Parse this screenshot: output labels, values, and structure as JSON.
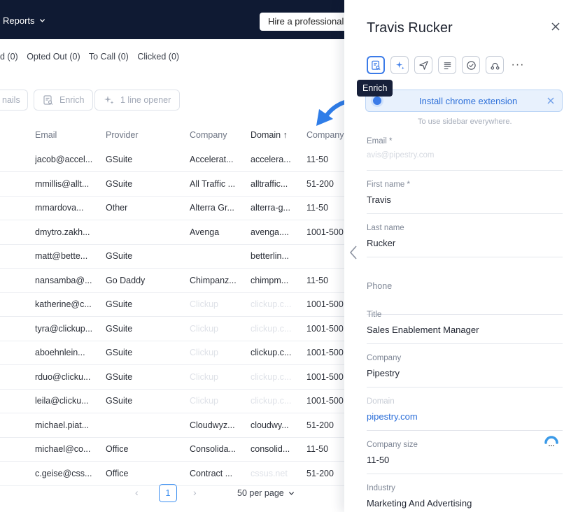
{
  "topbar": {
    "reports_label": "Reports",
    "hire_label": "Hire a professional"
  },
  "filters": [
    "d (0)",
    "Opted Out (0)",
    "To Call (0)",
    "Clicked (0)"
  ],
  "actions": {
    "emails_label": "nails",
    "enrich_label": "Enrich",
    "opener_label": "1 line opener"
  },
  "table": {
    "headers": {
      "email": "Email",
      "provider": "Provider",
      "company": "Company",
      "domain": "Domain ↑",
      "size": "Company"
    },
    "rows": [
      {
        "email": "jacob@accel...",
        "provider": "GSuite",
        "company": "Accelerat...",
        "domain": "accelera...",
        "size": "11-50"
      },
      {
        "email": "mmillis@allt...",
        "provider": "GSuite",
        "company": "All Traffic ...",
        "domain": "alltraffic...",
        "size": "51-200"
      },
      {
        "email": "mmardova...",
        "provider": "Other",
        "company": "Alterra Gr...",
        "domain": "alterra-g...",
        "size": "11-50"
      },
      {
        "email": "dmytro.zakh...",
        "provider": "",
        "company": "Avenga",
        "domain": "avenga....",
        "size": "1001-500"
      },
      {
        "email": "matt@bette...",
        "provider": "GSuite",
        "company": "",
        "domain": "betterlin...",
        "size": ""
      },
      {
        "email": "nansamba@...",
        "provider": "Go Daddy",
        "company": "Chimpanz...",
        "domain": "chimpm...",
        "size": "11-50"
      },
      {
        "email": "katherine@c...",
        "provider": "GSuite",
        "company": "Clickup",
        "domain": "clickup.c...",
        "size": "1001-500",
        "faded_company": true,
        "faded_domain": true
      },
      {
        "email": "tyra@clickup...",
        "provider": "GSuite",
        "company": "Clickup",
        "domain": "clickup.c...",
        "size": "1001-500",
        "faded_company": true,
        "faded_domain": true
      },
      {
        "email": "aboehnlein...",
        "provider": "GSuite",
        "company": "Clickup",
        "domain": "clickup.c...",
        "size": "1001-500",
        "faded_company": true,
        "faded_domain": false
      },
      {
        "email": "rduo@clicku...",
        "provider": "GSuite",
        "company": "Clickup",
        "domain": "clickup.c...",
        "size": "1001-500",
        "faded_company": true,
        "faded_domain": true
      },
      {
        "email": "leila@clicku...",
        "provider": "GSuite",
        "company": "Clickup",
        "domain": "clickup.c...",
        "size": "1001-500",
        "faded_company": true,
        "faded_domain": true
      },
      {
        "email": "michael.piat...",
        "provider": "",
        "company": "Cloudwyz...",
        "domain": "cloudwy...",
        "size": "51-200"
      },
      {
        "email": "michael@co...",
        "provider": "Office",
        "company": "Consolida...",
        "domain": "consolid...",
        "size": "11-50"
      },
      {
        "email": "c.geise@css...",
        "provider": "Office",
        "company": "Contract ...",
        "domain": "cssus.net",
        "size": "51-200",
        "faded_domain": true
      }
    ]
  },
  "pager": {
    "prev": "‹",
    "page": "1",
    "next": "›",
    "per_page": "50 per page"
  },
  "panel": {
    "title": "Travis Rucker",
    "tooltip": "Enrich",
    "more": "···",
    "banner_text": "Install chrome extension",
    "banner_sub": "To use sidebar everywhere.",
    "fields": [
      {
        "label": "Email *",
        "value": "avis@pipestry.com",
        "placeholder": true
      },
      {
        "label": "First name *",
        "value": "Travis"
      },
      {
        "label": "Last name",
        "value": "Rucker"
      },
      {
        "label": "",
        "value": "Phone",
        "as_label": true
      },
      {
        "label": "Title",
        "value": "Sales Enablement Manager"
      },
      {
        "label": "Company",
        "value": "Pipestry"
      },
      {
        "label": "Domain",
        "value": "pipestry.com",
        "link": true,
        "faded_label": true
      },
      {
        "label": "Company size",
        "value": "11-50"
      },
      {
        "label": "Industry",
        "value": "Marketing And Advertising"
      }
    ]
  },
  "colors": {
    "accent": "#3b7be8",
    "topbar": "#0f1a33",
    "arrow": "#2f7de8"
  }
}
